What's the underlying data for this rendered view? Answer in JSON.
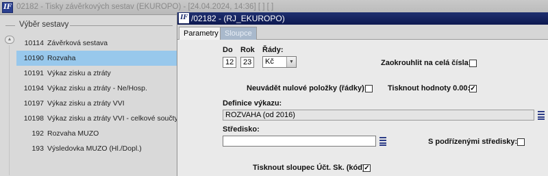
{
  "window": {
    "title": "02182 - Tisky závěrkových sestav (EKUROPO) - [24.04.2024, 14:36]  [ ]  [ ]"
  },
  "sidebar": {
    "header": "Výběr sestavy",
    "items": [
      {
        "code": "10114",
        "label": "Závěrková sestava"
      },
      {
        "code": "10190",
        "label": "Rozvaha"
      },
      {
        "code": "10191",
        "label": "Výkaz zisku a ztráty"
      },
      {
        "code": "10194",
        "label": "Výkaz zisku a ztráty - Ne/Hosp."
      },
      {
        "code": "10197",
        "label": "Výkaz zisku a ztráty VVI"
      },
      {
        "code": "10198",
        "label": "Výkaz zisku a ztráty VVI - celkové součty"
      },
      {
        "code": "192",
        "label": "Rozvaha MUZO"
      },
      {
        "code": "193",
        "label": "Výsledovka MUZO (Hl./Dopl.)"
      }
    ],
    "selected_index": 1
  },
  "dialog": {
    "title": "/02182 - (RJ_EKUROPO)",
    "tabs": [
      "Parametry",
      "Sloupce"
    ],
    "active_tab": 0
  },
  "form": {
    "do_label": "Do",
    "do_value": "12",
    "rok_label": "Rok",
    "rok_value": "23",
    "rady_label": "Řády:",
    "rady_value": "Kč",
    "round_label": "Zaokrouhlit na celá čísla:",
    "round_checked": "",
    "zero_rows_label": "Neuvádět nulové položky (řádky):",
    "zero_rows_checked": "",
    "print_zero_label": "Tisknout hodnoty 0.00:",
    "print_zero_checked": "✓",
    "definition_label": "Definice výkazu:",
    "definition_value": "ROZVAHA (od 2016)",
    "center_label": "Středisko:",
    "center_value": "",
    "sub_centers_label": "S podřízenými středisky:",
    "sub_centers_checked": "",
    "print_column_label": "Tisknout sloupec Účt. Sk. (kód):",
    "print_column_checked": "✓"
  },
  "icons": {
    "app_logo": "app-logo-icon",
    "list_picker": "list-picker-icon",
    "dropdown": "chevron-down-icon"
  },
  "colors": {
    "dialog_title_bg": "#1f2f6f",
    "selection": "#98c8ec",
    "inactive_tab": "#a9b9cc"
  }
}
